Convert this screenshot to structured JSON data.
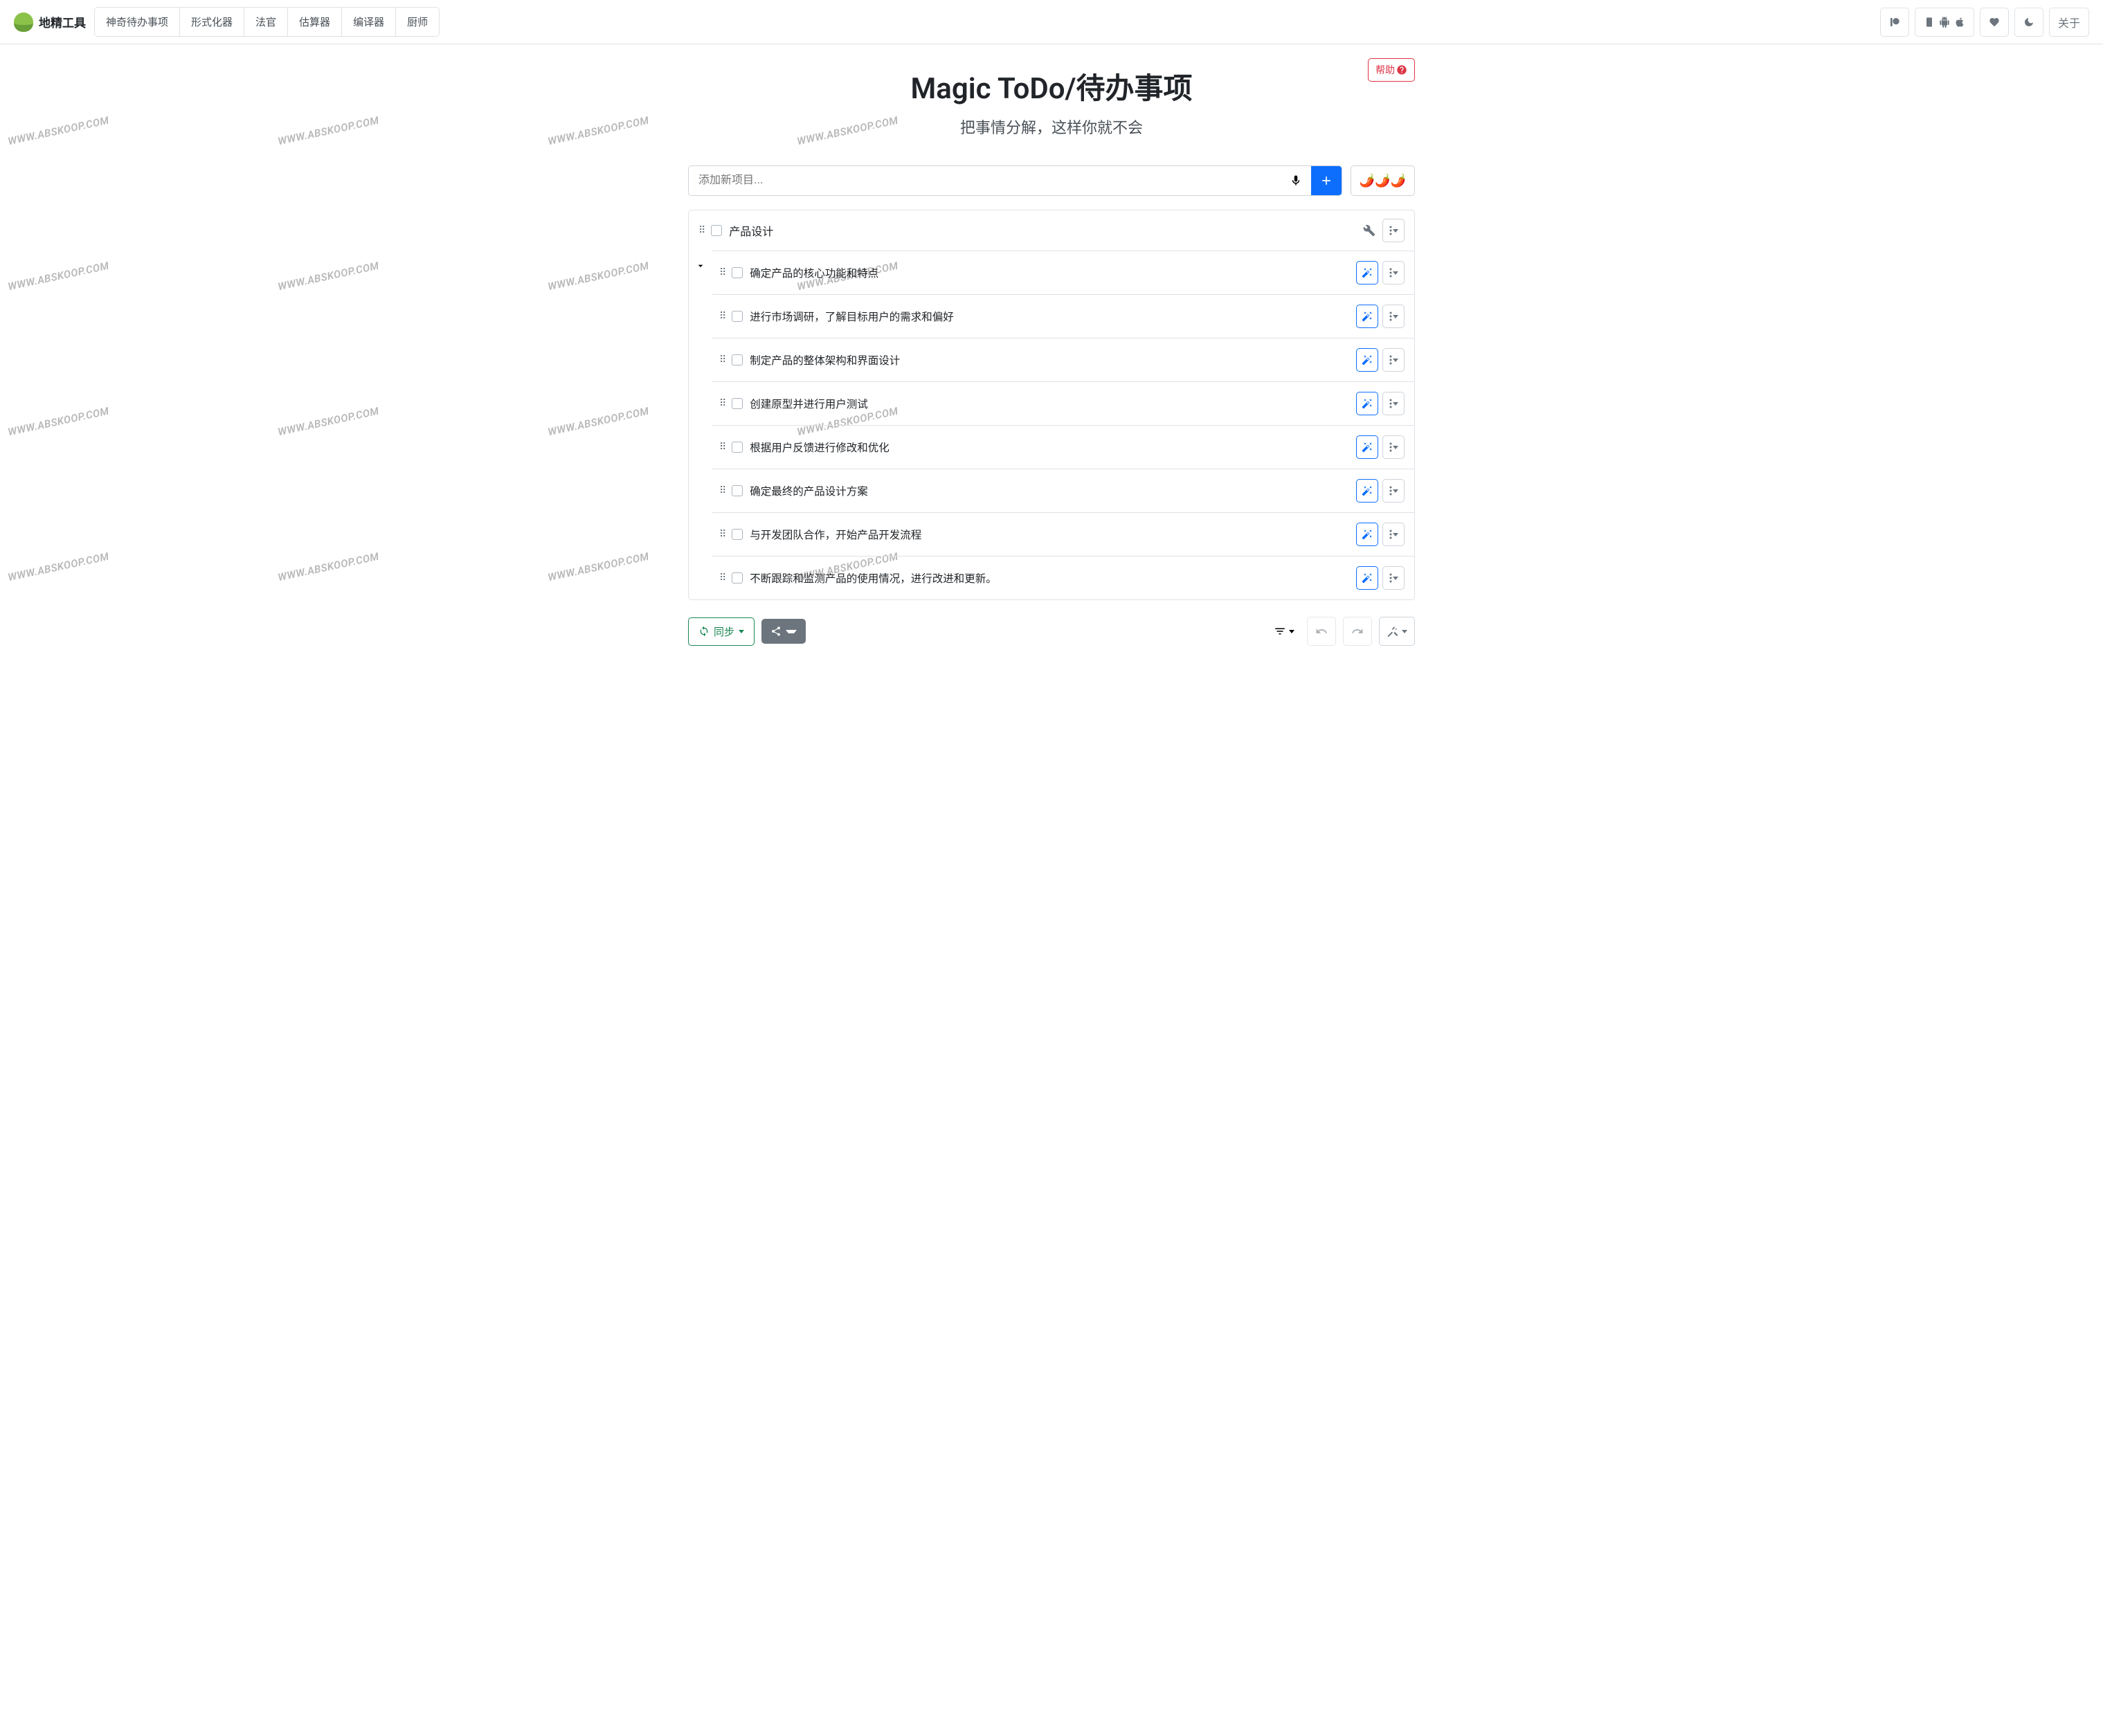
{
  "brand": "地精工具",
  "nav": [
    "神奇待办事项",
    "形式化器",
    "法官",
    "估算器",
    "编译器",
    "厨师"
  ],
  "about": "关于",
  "help": "帮助",
  "title": "Magic ToDo/待办事项",
  "subtitle": "把事情分解，这样你就不会",
  "input_placeholder": "添加新项目...",
  "spice": "🌶️🌶️🌶️",
  "parent_task": "产品设计",
  "children": [
    "确定产品的核心功能和特点",
    "进行市场调研，了解目标用户的需求和偏好",
    "制定产品的整体架构和界面设计",
    "创建原型并进行用户测试",
    "根据用户反馈进行修改和优化",
    "确定最终的产品设计方案",
    "与开发团队合作，开始产品开发流程",
    "不断跟踪和监测产品的使用情况，进行改进和更新。"
  ],
  "sync": "同步",
  "watermark": "WWW.ABSKOOP.COM"
}
